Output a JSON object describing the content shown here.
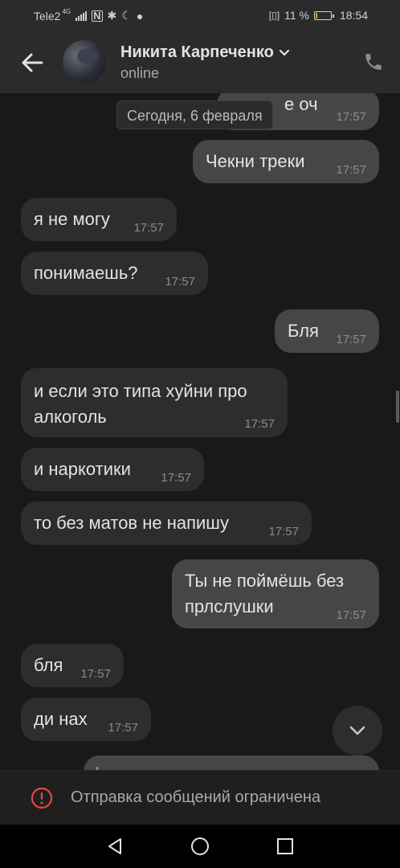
{
  "status_bar": {
    "carrier": "Tele2",
    "network_badge": "4G",
    "icons": [
      "nfc-icon",
      "bluetooth-icon",
      "moon-icon",
      "chat-notification-icon",
      "vibrate-icon"
    ],
    "battery_text": "11 %",
    "battery_level": 0.11,
    "time": "18:54"
  },
  "header": {
    "name": "Никита Карпеченко",
    "status": "online"
  },
  "chat": {
    "date_label": "Сегодня, 6 февраля",
    "messages": [
      {
        "dir": "out",
        "text": "е оч",
        "time": "17:57"
      },
      {
        "dir": "out",
        "text": "Чекни треки",
        "time": "17:57"
      },
      {
        "dir": "in",
        "text": "я не могу",
        "time": "17:57"
      },
      {
        "dir": "in",
        "text": "понимаешь?",
        "time": "17:57"
      },
      {
        "dir": "out",
        "text": "Бля",
        "time": "17:57"
      },
      {
        "dir": "in",
        "text": "и если это типа хуйни про алкоголь",
        "time": "17:57"
      },
      {
        "dir": "in",
        "text": "и наркотики",
        "time": "17:57"
      },
      {
        "dir": "in",
        "text": "то без матов не напишу",
        "time": "17:57"
      },
      {
        "dir": "out",
        "text": "Ты не поймёшь без прлслушки",
        "time": "17:57"
      },
      {
        "dir": "in",
        "text": "бля",
        "time": "17:57"
      },
      {
        "dir": "in",
        "text": "ди нах",
        "time": "17:57"
      }
    ]
  },
  "restriction": {
    "text": "Отправка сообщений ограничена"
  },
  "colors": {
    "background": "#19191a",
    "incoming_bubble": "#2c2d2e",
    "outgoing_bubble": "#454647",
    "alert_red": "#e64646"
  }
}
